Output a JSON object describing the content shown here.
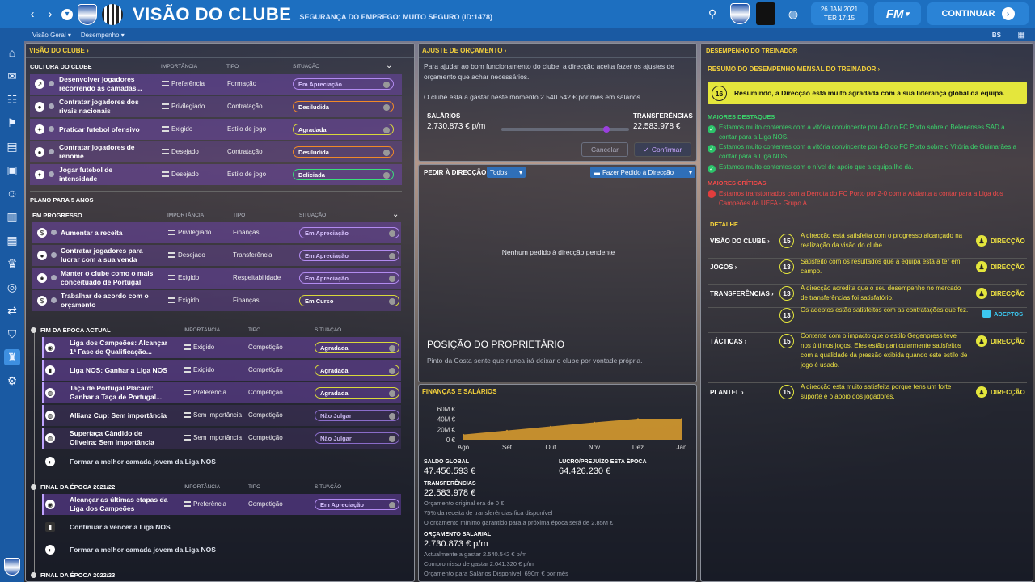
{
  "header": {
    "title": "VISÃO DO CLUBE",
    "subtitle": "SEGURANÇA DO EMPREGO: MUITO SEGURO (ID:1478)",
    "date_line1": "26 JAN 2021",
    "date_line2": "TER 17:15",
    "fm_label": "FM",
    "continue_label": "CONTINUAR"
  },
  "subnav": {
    "item1": "Visão Geral",
    "item2": "Desempenho",
    "bs": "BS"
  },
  "vision": {
    "panel_title": "VISÃO DO CLUBE",
    "culture_header": "CULTURA DO CLUBE",
    "col_importance": "IMPORTÂNCIA",
    "col_type": "TIPO",
    "col_status": "SITUAÇÃO",
    "culture": [
      {
        "text1": "Desenvolver jogadores",
        "text2": "recorrendo às camadas...",
        "importance": "Preferência",
        "type": "Formação",
        "status": "Em Apreciação",
        "style": "p-purple",
        "icon": "↗"
      },
      {
        "text1": "Contratar jogadores dos",
        "text2": "rivais nacionais",
        "importance": "Privilegiado",
        "type": "Contratação",
        "status": "Desiludida",
        "style": "p-orange",
        "icon": "●"
      },
      {
        "text1": "Praticar futebol ofensivo",
        "text2": "",
        "importance": "Exigido",
        "type": "Estilo de jogo",
        "status": "Agradada",
        "style": "p-yellow",
        "icon": "✦"
      },
      {
        "text1": "Contratar jogadores de",
        "text2": "renome",
        "importance": "Desejado",
        "type": "Contratação",
        "status": "Desiludida",
        "style": "p-orange",
        "icon": "●"
      },
      {
        "text1": "Jogar futebol de",
        "text2": "intensidade",
        "importance": "Desejado",
        "type": "Estilo de jogo",
        "status": "Deliciada",
        "style": "p-green",
        "icon": "✦"
      }
    ],
    "plan_header": "PLANO PARA 5 ANOS",
    "in_progress_header": "EM PROGRESSO",
    "plan": [
      {
        "text1": "Aumentar a receita",
        "text2": "",
        "importance": "Privilegiado",
        "type": "Finanças",
        "status": "Em Apreciação",
        "style": "p-purple",
        "icon": "$"
      },
      {
        "text1": "Contratar jogadores para",
        "text2": "lucrar com a sua venda",
        "importance": "Desejado",
        "type": "Transferência",
        "status": "Em Apreciação",
        "style": "p-purple",
        "icon": "●"
      },
      {
        "text1": "Manter o clube como o mais",
        "text2": "conceituado de Portugal",
        "importance": "Exigido",
        "type": "Respeitabilidade",
        "status": "Em Apreciação",
        "style": "p-purple",
        "icon": "★"
      },
      {
        "text1": "Trabalhar de acordo com o",
        "text2": "orçamento",
        "importance": "Exigido",
        "type": "Finanças",
        "status": "Em Curso",
        "style": "p-yellow",
        "icon": "$"
      }
    ],
    "end_season_header": "FIM DA ÉPOCA ACTUAL",
    "end_season": [
      {
        "text1": "Liga dos Campeões: Alcançar",
        "text2": "1ª Fase de Qualificação...",
        "importance": "Exigido",
        "type": "Competição",
        "status": "Agradada",
        "style": "p-yellow"
      },
      {
        "text1": "Liga NOS: Ganhar a Liga NOS",
        "text2": "",
        "importance": "Exigido",
        "type": "Competição",
        "status": "Agradada",
        "style": "p-yellow"
      },
      {
        "text1": "Taça de Portugal Placard:",
        "text2": "Ganhar a Taça de Portugal...",
        "importance": "Preferência",
        "type": "Competição",
        "status": "Agradada",
        "style": "p-yellow"
      },
      {
        "text1": "Allianz Cup: Sem importância",
        "text2": "",
        "importance": "Sem importância",
        "type": "Competição",
        "status": "Não Julgar",
        "style": "p-lilac"
      },
      {
        "text1": "Supertaça Cândido de",
        "text2": "Oliveira: Sem importância",
        "importance": "Sem importância",
        "type": "Competição",
        "status": "Não Julgar",
        "style": "p-lilac"
      }
    ],
    "youth1": "Formar a melhor camada jovem da Liga NOS",
    "end2122_header": "FINAL DA ÉPOCA 2021/22",
    "end2122": [
      {
        "text1": "Alcançar as últimas etapas da",
        "text2": "Liga dos Campeões",
        "importance": "Preferência",
        "type": "Competição",
        "status": "Em Apreciação",
        "style": "p-purple"
      }
    ],
    "win_league": "Continuar a vencer a Liga NOS",
    "youth2": "Formar a melhor camada jovem da Liga NOS",
    "end2223_header": "FINAL DA ÉPOCA 2022/23"
  },
  "budget": {
    "title": "AJUSTE DE ORÇAMENTO",
    "desc": "Para ajudar ao bom funcionamento do clube, a direcção aceita fazer os ajustes de orçamento que achar necessários.",
    "spend": "O clube está a gastar neste momento 2.540.542 € por mês em salários.",
    "salaries_label": "SALÁRIOS",
    "salaries_value": "2.730.873 € p/m",
    "transfers_label": "TRANSFERÊNCIAS",
    "transfers_value": "22.583.978 €",
    "cancel": "Cancelar",
    "confirm": "Confirmar",
    "slider_fraction": 0.82
  },
  "requests": {
    "title": "PEDIR À DIRECÇÃO",
    "filter": "Todos",
    "make_request": "Fazer Pedido à Direcção",
    "empty": "Nenhum pedido à direcção pendente"
  },
  "owner": {
    "title": "POSIÇÃO DO PROPRIETÁRIO",
    "text": "Pinto da Costa sente que nunca irá deixar o clube por vontade própria."
  },
  "finance": {
    "title": "FINANÇAS E SALÁRIOS",
    "balance_label": "SALDO GLOBAL",
    "balance_value": "47.456.593 €",
    "profit_label": "LUCRO/PREJUÍZO ESTA ÉPOCA",
    "profit_value": "64.426.230 €",
    "transfers_label": "TRANSFERÊNCIAS",
    "transfers_value": "22.583.978 €",
    "transfers_note1": "Orçamento original era de 0 €",
    "transfers_note2": "75% da receita de transferências fica disponível",
    "transfers_note3": "O orçamento mínimo garantido para a próxima época será de 2,85M €",
    "wage_label": "ORÇAMENTO SALARIAL",
    "wage_value": "2.730.873 € p/m",
    "wage_note1": "Actualmente a gastar 2.540.542 € p/m",
    "wage_note2": "Compromisso de gastar 2.041.320 € p/m",
    "wage_note3": "Orçamento para Salários Disponível: 690m € por mês"
  },
  "chart_data": {
    "type": "area",
    "categories": [
      "Ago",
      "Set",
      "Out",
      "Nov",
      "Dez",
      "Jan"
    ],
    "yticks": [
      "60M €",
      "40M €",
      "20M €",
      "0 €"
    ],
    "ylim": [
      0,
      60
    ],
    "values": [
      10,
      18,
      26,
      34,
      41,
      41
    ],
    "color": "#e0a12e"
  },
  "coach": {
    "title": "DESEMPENHO DO TREINADOR",
    "monthly": "RESUMO DO DESEMPENHO MENSAL DO TREINADOR",
    "summary_num": "16",
    "summary": "Resumindo, a Direcção está muito agradada com a sua liderança global da equipa.",
    "highlights_title": "MAIORES DESTAQUES",
    "highlights": [
      "Estamos muito contentes com a vitória convincente por 4-0 do FC Porto sobre o Belenenses SAD a contar para a Liga NOS.",
      "Estamos muito contentes com a vitória convincente por 4-0 do FC Porto sobre o Vitória de Guimarães a contar para a Liga NOS.",
      "Estamos muito contentes com o nível de apoio que a equipa lhe dá."
    ],
    "criticism_title": "MAIORES CRÍTICAS",
    "criticism": "Estamos transtornados com a Derrota do FC Porto por 2-0 com a Atalanta a contar para a Liga dos Campeões da UEFA - Grupo A.",
    "detail_title": "DETALHE",
    "details": [
      {
        "label": "VISÃO DO CLUBE",
        "num": "15",
        "text": "A direcção está satisfeita com o progresso alcançado na realização da visão do clube.",
        "who": "DIRECÇÃO"
      },
      {
        "label": "JOGOS",
        "num": "13",
        "text": "Satisfeito com os resultados que a equipa está a ter em campo.",
        "who": "DIRECÇÃO"
      },
      {
        "label": "TRANSFERÊNCIAS",
        "num": "13",
        "text": "A direcção acredita que o seu desempenho no mercado de transferências foi satisfatório.",
        "who": "DIRECÇÃO"
      },
      {
        "label": "",
        "num": "13",
        "text": "Os adeptos estão satisfeitos com as contratações que fez.",
        "who": "ADEPTOS"
      },
      {
        "label": "TÁCTICAS",
        "num": "15",
        "text": "Contente com o impacto que o estilo Gegenpress teve nos últimos jogos. Eles estão particularmente satisfeitos com a qualidade da pressão exibida quando este estilo de jogo é usado.",
        "who": "DIRECÇÃO"
      },
      {
        "label": "PLANTEL",
        "num": "15",
        "text": "A direcção está muito satisfeita porque tens um forte suporte e o apoio dos jogadores.",
        "who": "DIRECÇÃO"
      }
    ]
  }
}
